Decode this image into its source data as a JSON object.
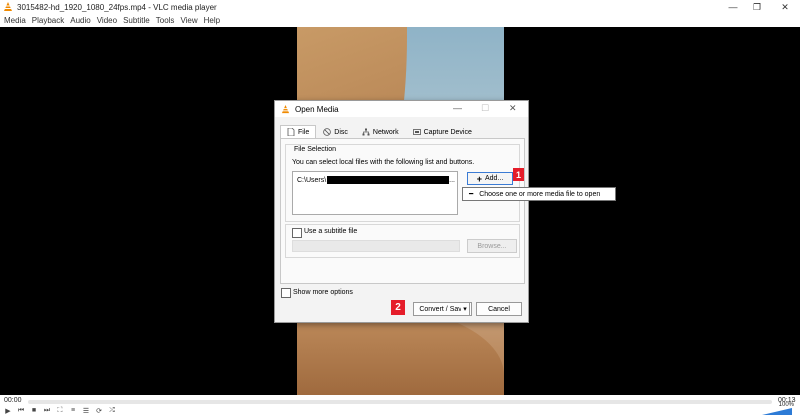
{
  "window": {
    "title": "3015482-hd_1920_1080_24fps.mp4 - VLC media player",
    "controls": [
      "minimize",
      "maximize",
      "close"
    ]
  },
  "menu": [
    "Media",
    "Playback",
    "Audio",
    "Video",
    "Subtitle",
    "Tools",
    "View",
    "Help"
  ],
  "dialog": {
    "title": "Open Media",
    "tabs": [
      "File",
      "Disc",
      "Network",
      "Capture Device"
    ],
    "file_selection_label": "File Selection",
    "description": "You can select local files with the following list and buttons.",
    "file_path_prefix": "C:\\Users\\",
    "file_path_suffix": "...",
    "add_label": "Add...",
    "tooltip": "Choose one or more media file to open",
    "subtitle_label": "Use a subtitle file",
    "browse_label": "Browse...",
    "show_more_label": "Show more options",
    "convert_label": "Convert / Save",
    "convert_arrow": "▾",
    "cancel_label": "Cancel"
  },
  "annotations": [
    "1",
    "2"
  ],
  "player": {
    "time_elapsed": "00:00",
    "time_total": "00:13",
    "volume": "100%",
    "progress": 0
  },
  "colors": {
    "accent": "#3b7bd4",
    "badge": "#e51d2a",
    "vlc_orange": "#f08a00",
    "volume_bar": "#2d7bd6"
  }
}
